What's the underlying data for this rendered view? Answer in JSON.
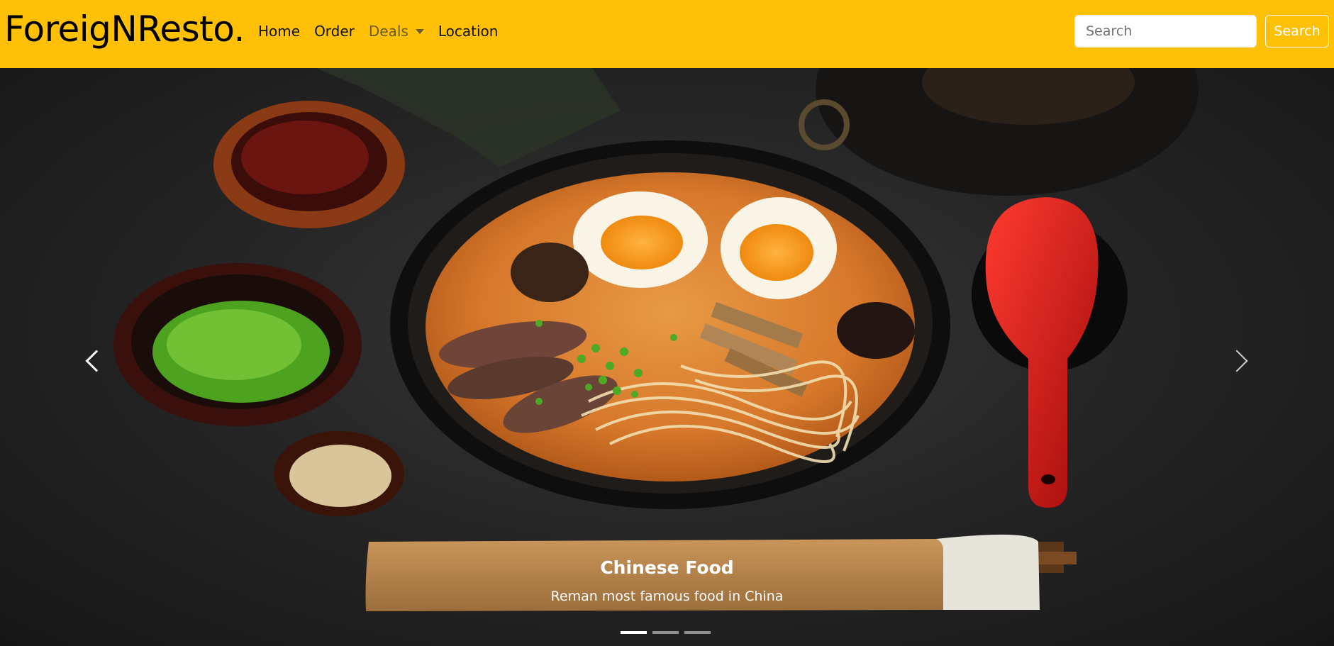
{
  "brand": "ForeigNResto.",
  "nav": {
    "home": "Home",
    "order": "Order",
    "deals": "Deals",
    "location": "Location"
  },
  "search": {
    "placeholder": "Search",
    "button": "Search"
  },
  "carousel": {
    "slide": {
      "title": "Chinese Food",
      "subtitle": "Reman most famous food in China"
    },
    "indicator_count": 3,
    "active_index": 0
  },
  "colors": {
    "navbar": "#ffc107",
    "accent_spoon": "#cc1010"
  },
  "icons": {
    "prev": "chevron-left-icon",
    "next": "chevron-right-icon",
    "deals_dropdown": "caret-down-icon"
  }
}
